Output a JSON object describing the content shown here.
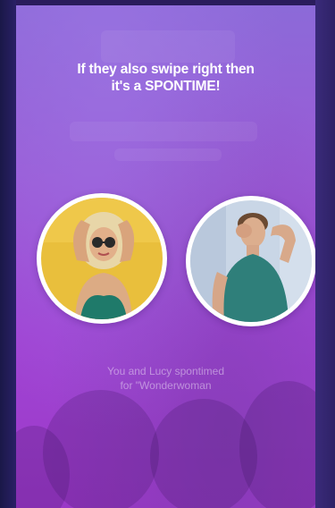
{
  "match_screen": {
    "headline_line1": "If they also swipe right then",
    "headline_line2": "it's a SPONTIME!",
    "caption_line1": "You and Lucy spontimed",
    "caption_line2": "for \"Wonderwoman"
  },
  "avatars": {
    "left": "photo-woman-yellow-background",
    "right": "photo-man-teal-shirt"
  },
  "colors": {
    "gradient_top": "#8c6ad8",
    "gradient_bottom": "#9c38c8",
    "avatar_ring": "#ffffff"
  }
}
